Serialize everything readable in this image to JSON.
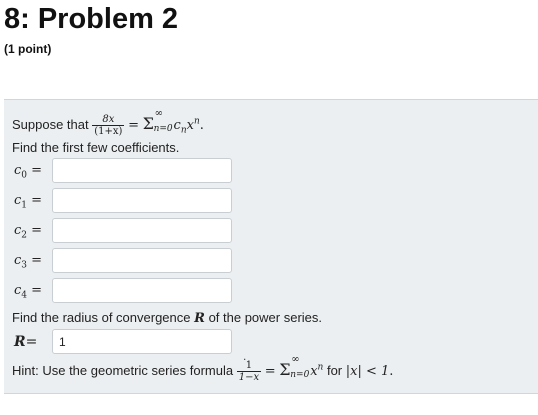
{
  "page": {
    "title": "8: Problem 2",
    "points": "(1 point)"
  },
  "problem": {
    "intro": "Suppose that",
    "frac_num": "8x",
    "frac_den": "(1+x)",
    "eq": "=",
    "sum_sym": "Σ",
    "sum_upper": "∞",
    "sum_lower": "n=0",
    "series_term": "c",
    "series_sub": "n",
    "series_var": "x",
    "series_exp": "n",
    "period": ".",
    "find_coef": "Find the first few coefficients.",
    "coefficients": [
      {
        "base": "c",
        "sub": "0",
        "eq": "=",
        "value": ""
      },
      {
        "base": "c",
        "sub": "1",
        "eq": "=",
        "value": ""
      },
      {
        "base": "c",
        "sub": "2",
        "eq": "=",
        "value": ""
      },
      {
        "base": "c",
        "sub": "3",
        "eq": "=",
        "value": ""
      },
      {
        "base": "c",
        "sub": "4",
        "eq": "=",
        "value": ""
      }
    ],
    "radius_prompt_a": "Find the radius of convergence",
    "radius_var": "R",
    "radius_prompt_b": "of the power series.",
    "radius_label": "R",
    "radius_eq": "=",
    "radius_value": "1",
    "radius_dot": ".",
    "hint_text": "Hint: Use the geometric series formula",
    "hint_num": "1",
    "hint_den": "1−x",
    "hint_eq": "=",
    "hint_var": "x",
    "hint_exp": "n",
    "hint_for": "for",
    "hint_cond": "|x| < 1",
    "hint_period": "."
  }
}
